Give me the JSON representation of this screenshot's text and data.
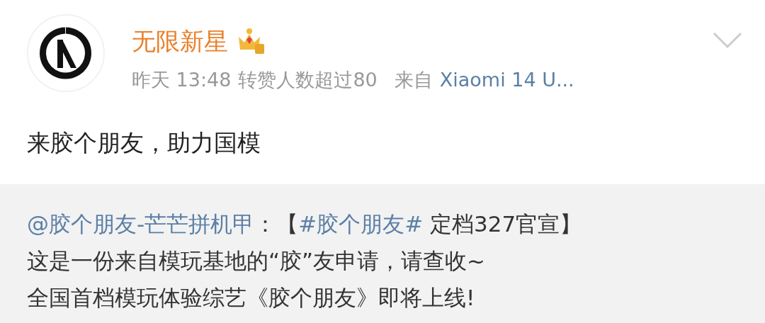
{
  "post": {
    "author": "无限新星",
    "time": "昨天 13:48",
    "stat": "转赞人数超过80",
    "source_prefix": "来自",
    "source": "Xiaomi 14 U...",
    "text": "来胶个朋友，助力国模"
  },
  "repost": {
    "lines": [
      {
        "segments": [
          {
            "kind": "mention",
            "text": "@胶个朋友-芒芒拼机甲"
          },
          {
            "kind": "plain",
            "text": "：【"
          },
          {
            "kind": "topic",
            "text": "#胶个朋友#"
          },
          {
            "kind": "plain",
            "text": " 定档327官宣】"
          }
        ]
      },
      {
        "segments": [
          {
            "kind": "plain",
            "text": "这是一份来自模玩基地的“胶”友申请，请查收~"
          }
        ]
      },
      {
        "segments": [
          {
            "kind": "plain",
            "text": "全国首档模玩体验综艺《胶个朋友》即将上线!"
          }
        ]
      }
    ]
  }
}
